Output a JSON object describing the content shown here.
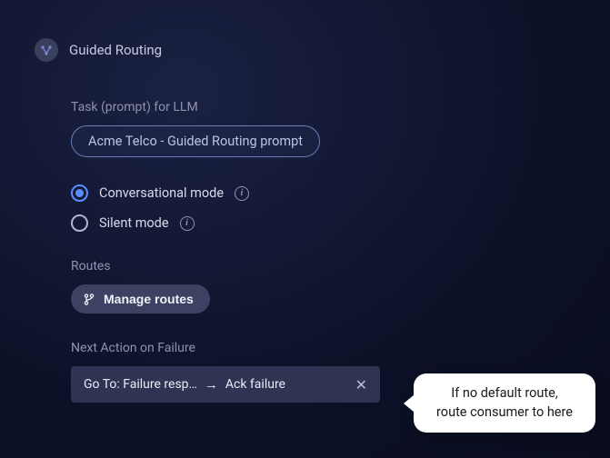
{
  "header": {
    "title": "Guided Routing"
  },
  "task": {
    "label": "Task (prompt) for LLM",
    "prompt_name": "Acme Telco - Guided Routing prompt"
  },
  "modes": {
    "options": [
      {
        "label": "Conversational mode",
        "selected": true
      },
      {
        "label": "Silent mode",
        "selected": false
      }
    ]
  },
  "routes": {
    "label": "Routes",
    "manage_label": "Manage routes"
  },
  "failure": {
    "label": "Next Action on Failure",
    "goto_text": "Go To: Failure resp…",
    "target_text": "Ack failure"
  },
  "tooltip": {
    "line1": "If no default route,",
    "line2": "route consumer to here"
  }
}
